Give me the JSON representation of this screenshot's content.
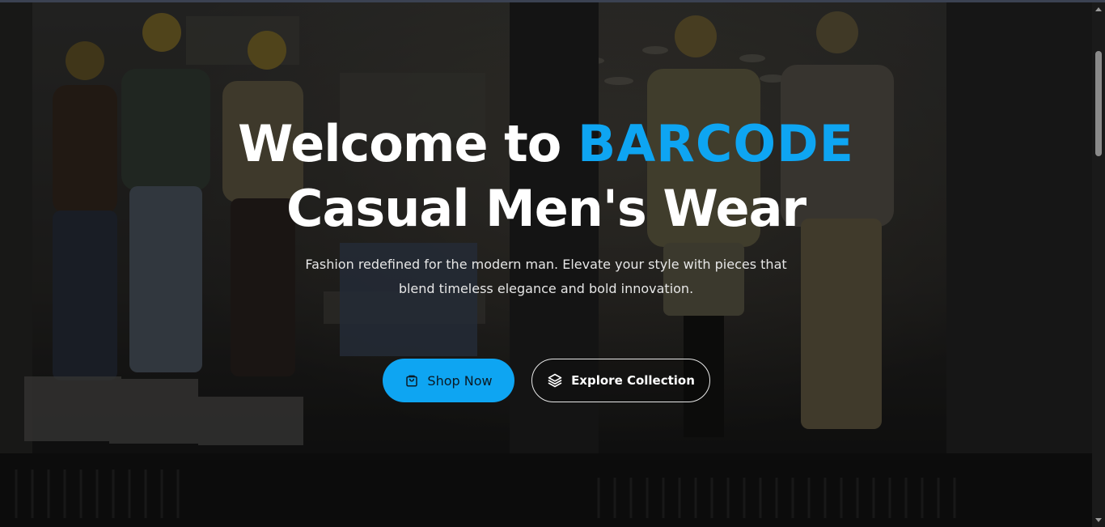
{
  "hero": {
    "headline_prefix": "Welcome to ",
    "brand_name": "BARCODE",
    "headline_line2": "Casual Men's Wear",
    "subtitle": "Fashion redefined for the modern man. Elevate your style with pieces that blend timeless elegance and bold innovation."
  },
  "buttons": {
    "shop_now": {
      "label": "Shop Now",
      "icon": "shopping-bag-icon"
    },
    "explore_collection": {
      "label": "Explore Collection",
      "icon": "layers-icon"
    }
  },
  "colors": {
    "accent": "#0ea5f2",
    "text": "#ffffff"
  }
}
